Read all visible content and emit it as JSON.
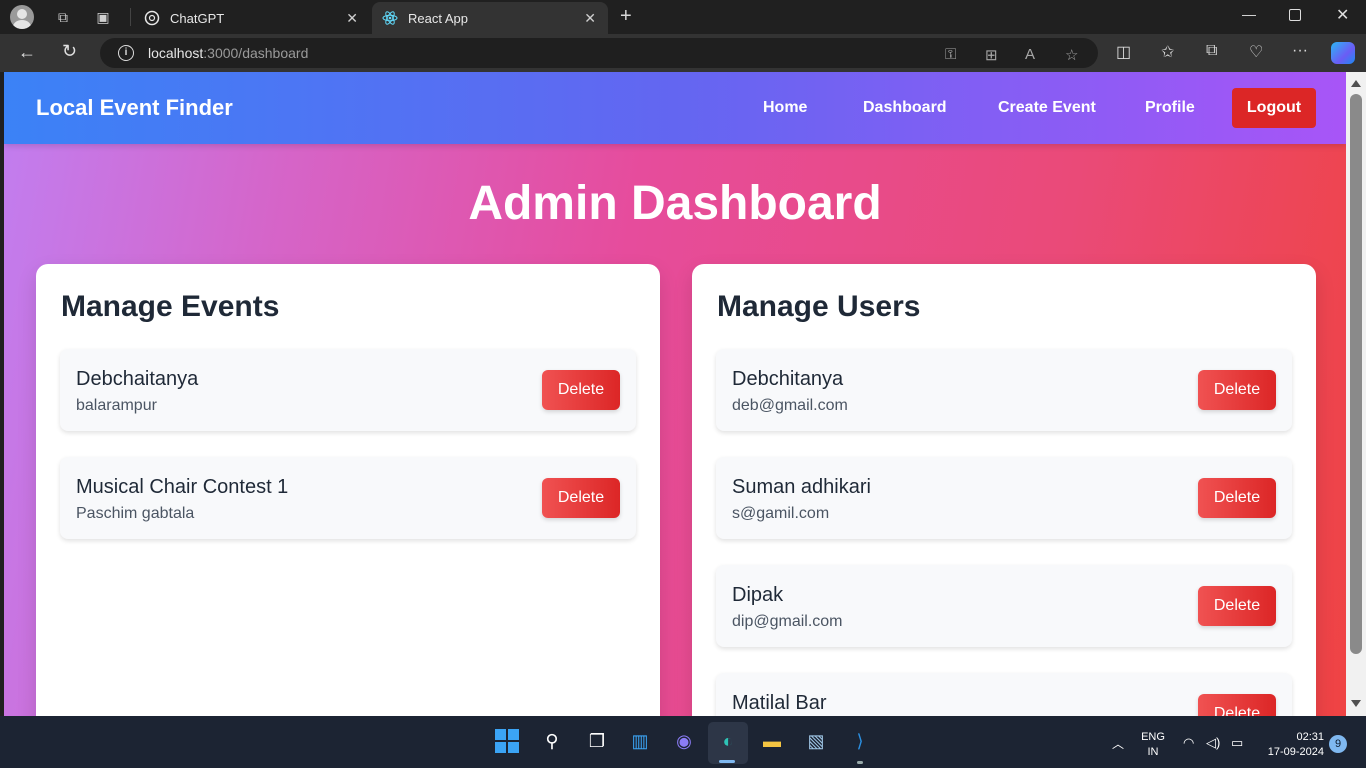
{
  "browser": {
    "tabs": [
      {
        "title": "ChatGPT"
      },
      {
        "title": "React App"
      }
    ],
    "url": {
      "host": "localhost",
      "rest": ":3000/dashboard"
    }
  },
  "app": {
    "brand": "Local Event Finder",
    "nav": {
      "home": "Home",
      "dashboard": "Dashboard",
      "create_event": "Create Event",
      "profile": "Profile",
      "logout": "Logout"
    },
    "page_title": "Admin Dashboard",
    "events_panel": {
      "heading": "Manage Events",
      "items": [
        {
          "name": "Debchaitanya",
          "location": "balarampur",
          "action": "Delete"
        },
        {
          "name": "Musical Chair Contest 1",
          "location": "Paschim gabtala",
          "action": "Delete"
        }
      ]
    },
    "users_panel": {
      "heading": "Manage Users",
      "items": [
        {
          "name": "Debchitanya",
          "email": "deb@gmail.com",
          "action": "Delete"
        },
        {
          "name": "Suman adhikari",
          "email": "s@gamil.com",
          "action": "Delete"
        },
        {
          "name": "Dipak",
          "email": "dip@gmail.com",
          "action": "Delete"
        },
        {
          "name": "Matilal Bar",
          "email": "",
          "action": "Delete"
        }
      ]
    },
    "colors": {
      "navbar_start": "#3b82f6",
      "navbar_end": "#a855f7",
      "logout": "#dc2626",
      "delete": "#dc2626",
      "background_start": "#c17ef0",
      "background_end": "#ef4343"
    }
  },
  "taskbar": {
    "lang_top": "ENG",
    "lang_bottom": "IN",
    "time": "02:31",
    "date": "17-09-2024",
    "notifications": "9"
  }
}
